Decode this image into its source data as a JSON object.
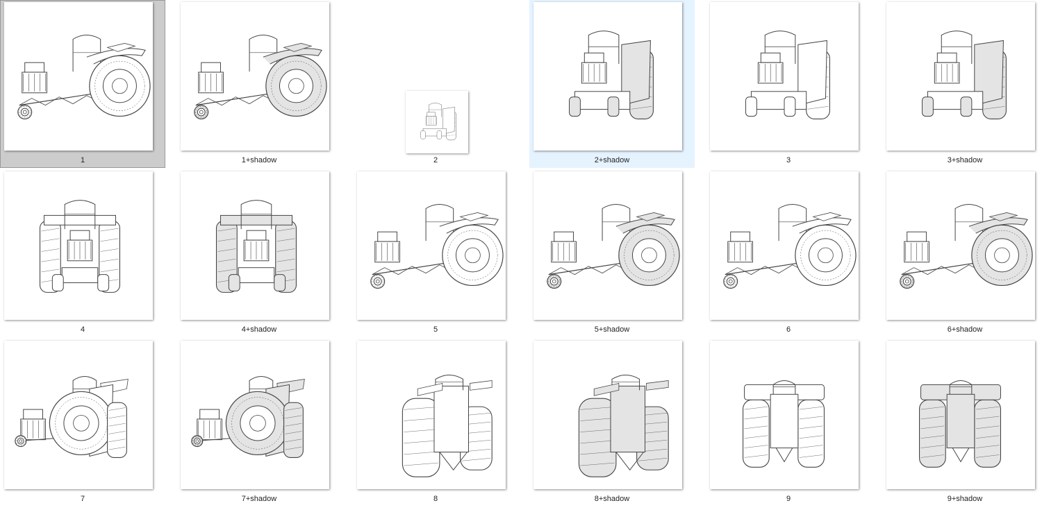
{
  "window": {
    "title": ""
  },
  "files": [
    {
      "label": "1",
      "view": "side-left",
      "shadow": false,
      "selected": true,
      "hover": false,
      "small": false
    },
    {
      "label": "1+shadow",
      "view": "side-left",
      "shadow": true,
      "selected": false,
      "hover": false,
      "small": false
    },
    {
      "label": "2",
      "view": "front-quarter",
      "shadow": false,
      "selected": false,
      "hover": false,
      "small": true
    },
    {
      "label": "2+shadow",
      "view": "front-quarter",
      "shadow": true,
      "selected": false,
      "hover": true,
      "small": false
    },
    {
      "label": "3",
      "view": "front-quarter-2",
      "shadow": false,
      "selected": false,
      "hover": false,
      "small": false
    },
    {
      "label": "3+shadow",
      "view": "front-quarter-2",
      "shadow": true,
      "selected": false,
      "hover": false,
      "small": false
    },
    {
      "label": "4",
      "view": "front",
      "shadow": false,
      "selected": false,
      "hover": false,
      "small": false
    },
    {
      "label": "4+shadow",
      "view": "front",
      "shadow": true,
      "selected": false,
      "hover": false,
      "small": false
    },
    {
      "label": "5",
      "view": "side-left",
      "shadow": false,
      "selected": false,
      "hover": false,
      "small": false
    },
    {
      "label": "5+shadow",
      "view": "side-left",
      "shadow": true,
      "selected": false,
      "hover": false,
      "small": false
    },
    {
      "label": "6",
      "view": "side-left-2",
      "shadow": false,
      "selected": false,
      "hover": false,
      "small": false
    },
    {
      "label": "6+shadow",
      "view": "side-left-2",
      "shadow": true,
      "selected": false,
      "hover": false,
      "small": false
    },
    {
      "label": "7",
      "view": "rear-quarter",
      "shadow": false,
      "selected": false,
      "hover": false,
      "small": false
    },
    {
      "label": "7+shadow",
      "view": "rear-quarter",
      "shadow": true,
      "selected": false,
      "hover": false,
      "small": false
    },
    {
      "label": "8",
      "view": "rear-quarter-2",
      "shadow": false,
      "selected": false,
      "hover": false,
      "small": false
    },
    {
      "label": "8+shadow",
      "view": "rear-quarter-2",
      "shadow": true,
      "selected": false,
      "hover": false,
      "small": false
    },
    {
      "label": "9",
      "view": "rear",
      "shadow": false,
      "selected": false,
      "hover": false,
      "small": false
    },
    {
      "label": "9+shadow",
      "view": "rear",
      "shadow": true,
      "selected": false,
      "hover": false,
      "small": false
    }
  ],
  "icons": {
    "thumbnail": "tractor-drawing-icon"
  },
  "colors": {
    "selected_bg": "#cccccc",
    "hover_bg": "#e5f3ff",
    "line": "#444444",
    "shadow_fill": "#e4e4e4"
  }
}
